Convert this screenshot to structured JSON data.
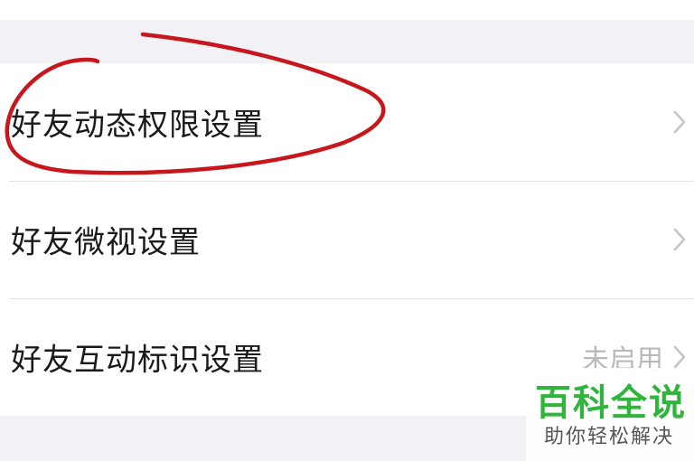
{
  "settings": {
    "items": [
      {
        "label": "好友动态权限设置",
        "value": ""
      },
      {
        "label": "好友微视设置",
        "value": ""
      },
      {
        "label": "好友互动标识设置",
        "value": "未启用"
      }
    ]
  },
  "annotation": {
    "color": "#c8161d"
  },
  "watermark": {
    "title": "百科全说",
    "subtitle": "助你轻松解决",
    "color": "#2fb43c"
  }
}
